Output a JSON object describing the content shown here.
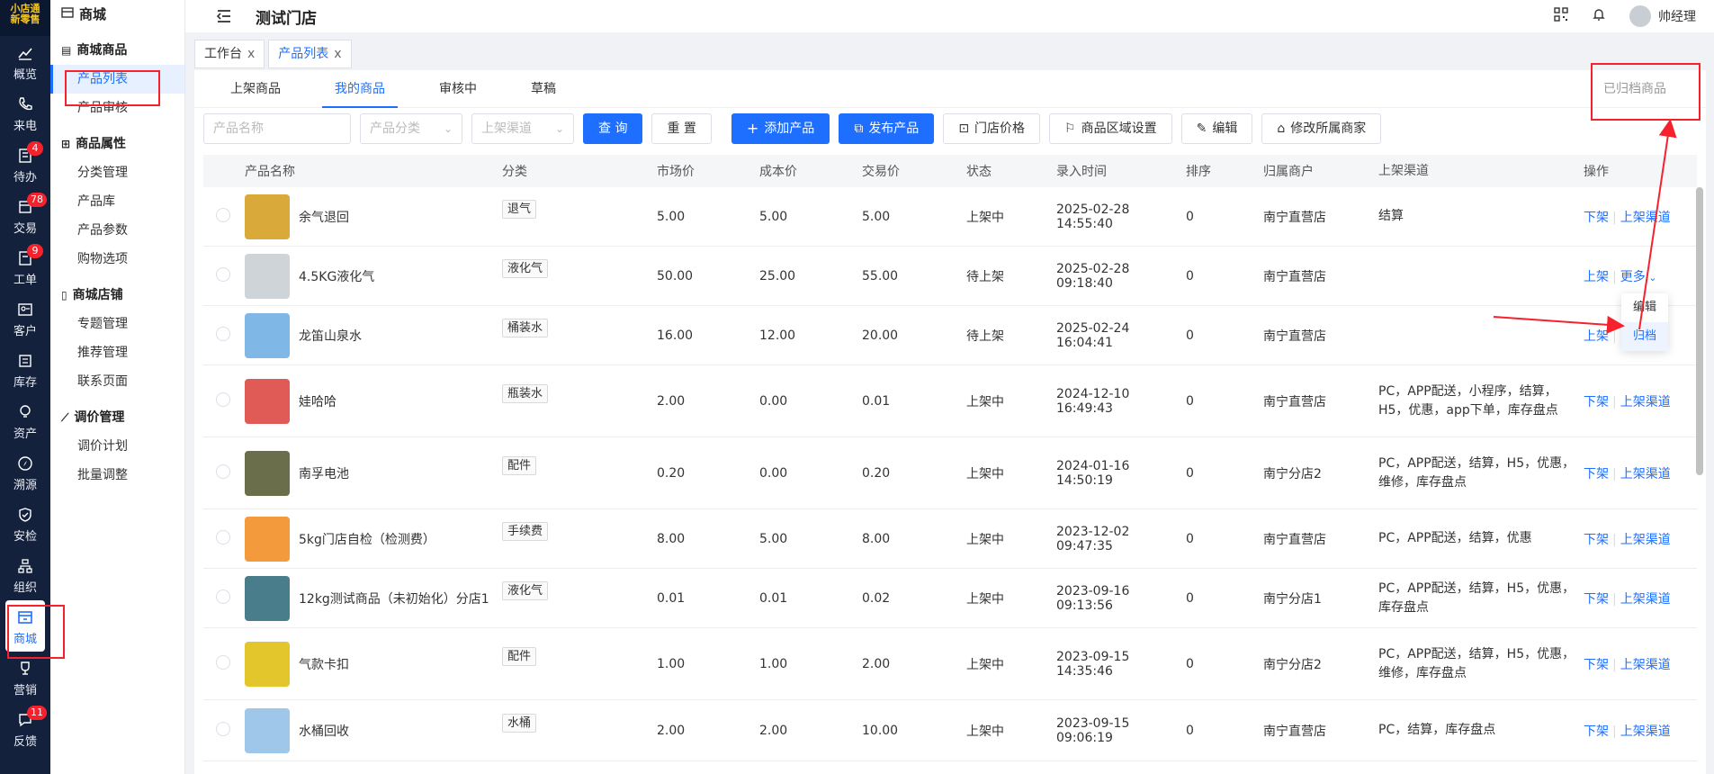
{
  "brand": {
    "logo_line1": "小店通",
    "logo_line2": "新零售"
  },
  "rail": [
    {
      "label": "概览",
      "icon": "chart-icon"
    },
    {
      "label": "来电",
      "icon": "phone-icon"
    },
    {
      "label": "待办",
      "icon": "todo-icon",
      "badge": "4"
    },
    {
      "label": "交易",
      "icon": "trade-icon",
      "badge": "78"
    },
    {
      "label": "工单",
      "icon": "ticket-icon",
      "badge": "9"
    },
    {
      "label": "客户",
      "icon": "customer-icon"
    },
    {
      "label": "库存",
      "icon": "inventory-icon"
    },
    {
      "label": "资产",
      "icon": "bulb-icon"
    },
    {
      "label": "溯源",
      "icon": "compass-icon"
    },
    {
      "label": "安检",
      "icon": "shield-icon"
    },
    {
      "label": "组织",
      "icon": "org-icon"
    },
    {
      "label": "商城",
      "icon": "shop-icon",
      "active": true
    },
    {
      "label": "营销",
      "icon": "trophy-icon"
    },
    {
      "label": "反馈",
      "icon": "feedback-icon",
      "badge": "11"
    }
  ],
  "submenu": {
    "title": "商城",
    "groups": [
      {
        "title": "商城商品",
        "items": [
          "产品列表",
          "产品审核"
        ]
      },
      {
        "title": "商品属性",
        "items": [
          "分类管理",
          "产品库",
          "产品参数",
          "购物选项"
        ]
      },
      {
        "title": "商城店铺",
        "items": [
          "专题管理",
          "推荐管理",
          "联系页面"
        ]
      },
      {
        "title": "调价管理",
        "items": [
          "调价计划",
          "批量调整"
        ]
      }
    ],
    "active_item": "产品列表"
  },
  "header": {
    "store_name": "测试门店",
    "user_name": "帅经理"
  },
  "page_tabs": [
    {
      "label": "工作台",
      "close": "x"
    },
    {
      "label": "产品列表",
      "close": "x",
      "active": true
    }
  ],
  "subtabs": [
    "上架商品",
    "我的商品",
    "审核中",
    "草稿"
  ],
  "archived_label": "已归档商品",
  "filters": {
    "name_placeholder": "产品名称",
    "category_placeholder": "产品分类",
    "channel_placeholder": "上架渠道",
    "query": "查 询",
    "reset": "重 置",
    "add": "添加产品",
    "publish": "发布产品",
    "store_price": "门店价格",
    "region": "商品区域设置",
    "edit": "编辑",
    "merchant": "修改所属商家"
  },
  "table": {
    "headers": [
      "产品名称",
      "分类",
      "市场价",
      "成本价",
      "交易价",
      "状态",
      "录入时间",
      "排序",
      "归属商户",
      "上架渠道",
      "操作"
    ],
    "rows": [
      {
        "name": "余气退回",
        "cat": "退气",
        "mkt": "5.00",
        "cost": "5.00",
        "trade": "5.00",
        "status": "上架中",
        "time": "2025-02-28 14:55:40",
        "sort": "0",
        "merchant": "南宁直营店",
        "channel": "结算",
        "op1": "下架",
        "op2": "上架渠道",
        "thumb": "#d9a93a"
      },
      {
        "name": "4.5KG液化气",
        "cat": "液化气",
        "mkt": "50.00",
        "cost": "25.00",
        "trade": "55.00",
        "status": "待上架",
        "time": "2025-02-28 09:18:40",
        "sort": "0",
        "merchant": "南宁直营店",
        "channel": "",
        "op1": "上架",
        "op2": "更多",
        "thumb": "#cfd4d8"
      },
      {
        "name": "龙笛山泉水",
        "cat": "桶装水",
        "mkt": "16.00",
        "cost": "12.00",
        "trade": "20.00",
        "status": "待上架",
        "time": "2025-02-24 16:04:41",
        "sort": "0",
        "merchant": "南宁直营店",
        "channel": "",
        "op1": "上架",
        "op2": "",
        "thumb": "#7fb7e6"
      },
      {
        "name": "娃哈哈",
        "cat": "瓶装水",
        "mkt": "2.00",
        "cost": "0.00",
        "trade": "0.01",
        "status": "上架中",
        "time": "2024-12-10 16:49:43",
        "sort": "0",
        "merchant": "南宁直营店",
        "channel": "PC，APP配送，小程序，结算，H5，优惠，app下单，库存盘点",
        "op1": "下架",
        "op2": "上架渠道",
        "thumb": "#e05b55"
      },
      {
        "name": "南孚电池",
        "cat": "配件",
        "mkt": "0.20",
        "cost": "0.00",
        "trade": "0.20",
        "status": "上架中",
        "time": "2024-01-16 14:50:19",
        "sort": "0",
        "merchant": "南宁分店2",
        "channel": "PC，APP配送，结算，H5，优惠，维修，库存盘点",
        "op1": "下架",
        "op2": "上架渠道",
        "thumb": "#6b6e4a"
      },
      {
        "name": "5kg门店自检（检测费）",
        "cat": "手续费",
        "mkt": "8.00",
        "cost": "5.00",
        "trade": "8.00",
        "status": "上架中",
        "time": "2023-12-02 09:47:35",
        "sort": "0",
        "merchant": "南宁直营店",
        "channel": "PC，APP配送，结算，优惠",
        "op1": "下架",
        "op2": "上架渠道",
        "thumb": "#f29a3c"
      },
      {
        "name": "12kg测试商品（未初始化）分店1",
        "cat": "液化气",
        "mkt": "0.01",
        "cost": "0.01",
        "trade": "0.02",
        "status": "上架中",
        "time": "2023-09-16 09:13:56",
        "sort": "0",
        "merchant": "南宁分店1",
        "channel": "PC，APP配送，结算，H5，优惠，库存盘点",
        "op1": "下架",
        "op2": "上架渠道",
        "thumb": "#4a7d8c"
      },
      {
        "name": "气款卡扣",
        "cat": "配件",
        "mkt": "1.00",
        "cost": "1.00",
        "trade": "2.00",
        "status": "上架中",
        "time": "2023-09-15 14:35:46",
        "sort": "0",
        "merchant": "南宁分店2",
        "channel": "PC，APP配送，结算，H5，优惠，维修，库存盘点",
        "op1": "下架",
        "op2": "上架渠道",
        "thumb": "#e3c52c"
      },
      {
        "name": "水桶回收",
        "cat": "水桶",
        "mkt": "2.00",
        "cost": "2.00",
        "trade": "10.00",
        "status": "上架中",
        "time": "2023-09-15 09:06:19",
        "sort": "0",
        "merchant": "南宁直营店",
        "channel": "PC，结算，库存盘点",
        "op1": "下架",
        "op2": "上架渠道",
        "thumb": "#9ec7e9"
      }
    ]
  },
  "popup": {
    "edit": "编辑",
    "archive": "归档"
  },
  "colors": {
    "primary": "#1e6fff",
    "rail_bg": "#14213d",
    "highlight": "#f5222d"
  }
}
